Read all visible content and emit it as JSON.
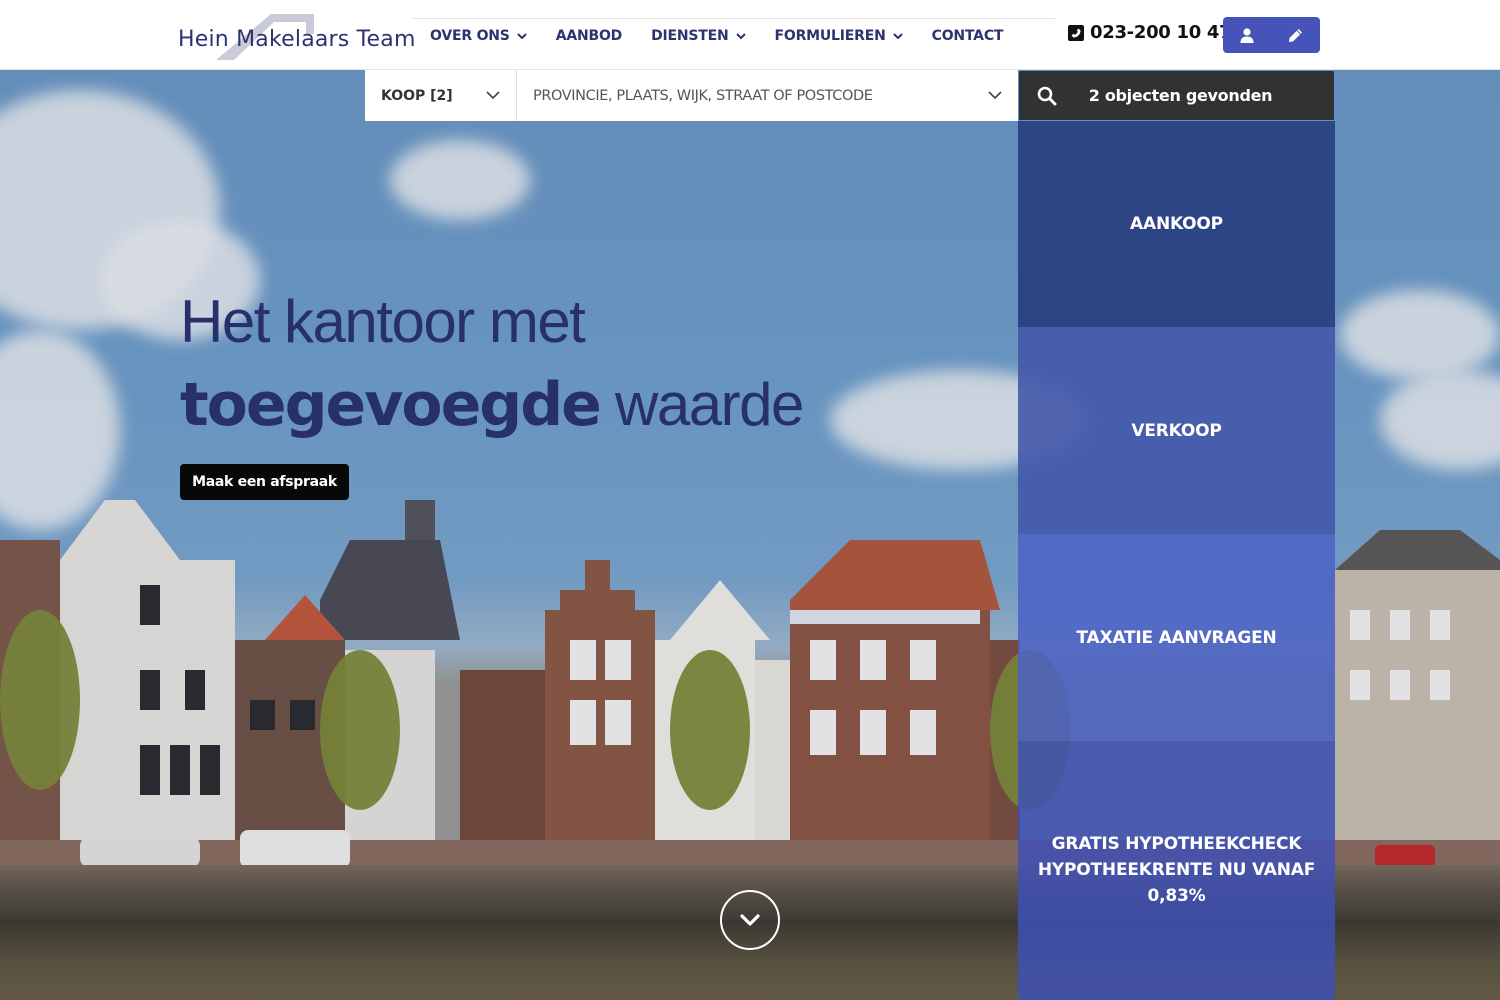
{
  "brand": {
    "name": "Hein Makelaars Team",
    "primary_color": "#2b3470",
    "accent_color": "#4653b8"
  },
  "nav": {
    "items": [
      {
        "label": "OVER ONS",
        "has_dropdown": true
      },
      {
        "label": "AANBOD",
        "has_dropdown": false
      },
      {
        "label": "DIENSTEN",
        "has_dropdown": true
      },
      {
        "label": "FORMULIEREN",
        "has_dropdown": true
      },
      {
        "label": "CONTACT",
        "has_dropdown": false
      }
    ]
  },
  "header": {
    "phone": "023-200 10 47",
    "phone_icon": "phone-square-icon",
    "account_icons": [
      "user-icon",
      "pencil-icon"
    ]
  },
  "search": {
    "type_value": "KOOP [2]",
    "location_placeholder": "PROVINCIE, PLAATS, WIJK, STRAAT OF POSTCODE",
    "results_label": "2 objecten gevonden",
    "search_icon": "search-icon"
  },
  "hero": {
    "line1": "Het kantoor met",
    "line2_bold": "toegevoegde",
    "line2_rest": " waarde",
    "cta_label": "Maak een afspraak",
    "scroll_icon": "chevron-down-circle-icon"
  },
  "panel": {
    "tiles": [
      {
        "label": "AANKOOP"
      },
      {
        "label": "VERKOOP"
      },
      {
        "label": "TAXATIE AANVRAGEN"
      },
      {
        "label_lines": [
          "GRATIS HYPOTHEEKCHECK",
          "HYPOTHEEKRENTE NU VANAF",
          "0,83%"
        ]
      }
    ]
  }
}
